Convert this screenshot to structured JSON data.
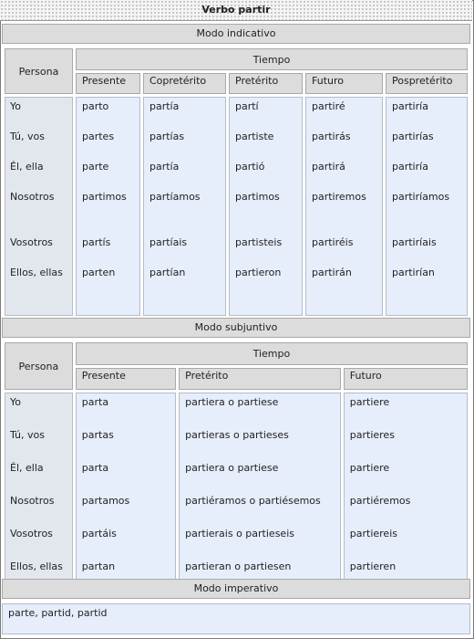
{
  "title": "Verbo partir",
  "indicative": {
    "section": "Modo indicativo",
    "persona": "Persona",
    "tiempo": "Tiempo",
    "tenses": [
      "Presente",
      "Copretérito",
      "Pretérito",
      "Futuro",
      "Pospretérito"
    ],
    "persons": [
      "Yo",
      "Tú, vos",
      "Él, ella",
      "Nosotros",
      "Vosotros",
      "Ellos, ellas"
    ],
    "forms": [
      [
        "parto",
        "partes",
        "parte",
        "partimos",
        "partís",
        "parten"
      ],
      [
        "partía",
        "partías",
        "partía",
        "partíamos",
        "partíais",
        "partían"
      ],
      [
        "partí",
        "partiste",
        "partió",
        "partimos",
        "partisteis",
        "partieron"
      ],
      [
        "partiré",
        "partirás",
        "partirá",
        "partiremos",
        "partiréis",
        "partirán"
      ],
      [
        "partiría",
        "partirías",
        "partiría",
        "partiríamos",
        "partiríais",
        "partirían"
      ]
    ]
  },
  "subjunctive": {
    "section": "Modo subjuntivo",
    "persona": "Persona",
    "tiempo": "Tiempo",
    "tenses": [
      "Presente",
      "Pretérito",
      "Futuro"
    ],
    "persons": [
      "Yo",
      "Tú, vos",
      "Él, ella",
      "Nosotros",
      "Vosotros",
      "Ellos, ellas"
    ],
    "forms": [
      [
        "parta",
        "partas",
        "parta",
        "partamos",
        "partáis",
        "partan"
      ],
      [
        "partiera o partiese",
        "partieras o partieses",
        "partiera o partiese",
        "partiéramos o partiésemos",
        "partierais o partieseis",
        "partieran o partiesen"
      ],
      [
        "partiere",
        "partieres",
        "partiere",
        "partiéremos",
        "partiereis",
        "partieren"
      ]
    ]
  },
  "imperative": {
    "section": "Modo imperativo",
    "forms": "parte, partid, partid"
  }
}
